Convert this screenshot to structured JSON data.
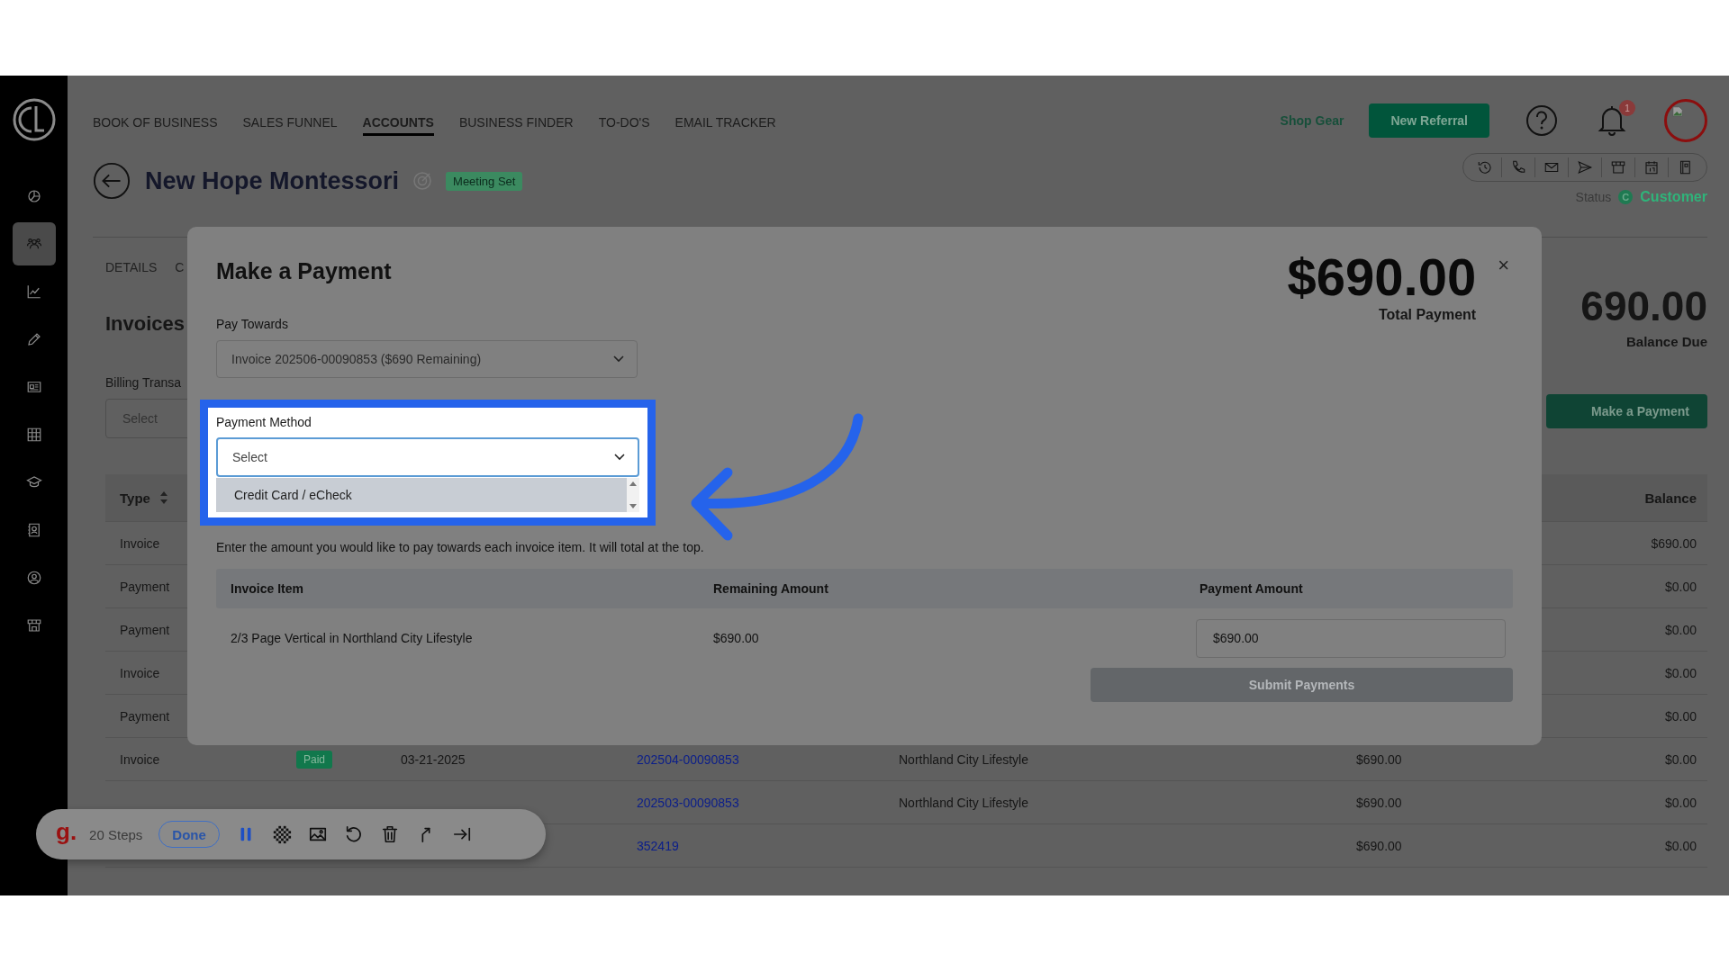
{
  "nav": {
    "items": [
      {
        "label": "BOOK OF BUSINESS",
        "selected": false
      },
      {
        "label": "SALES FUNNEL",
        "selected": false
      },
      {
        "label": "ACCOUNTS",
        "selected": true
      },
      {
        "label": "BUSINESS FINDER",
        "selected": false
      },
      {
        "label": "TO-DO'S",
        "selected": false
      },
      {
        "label": "EMAIL TRACKER",
        "selected": false
      }
    ],
    "shop_link": "Shop Gear",
    "referral_button": "New Referral",
    "notification_count": "1"
  },
  "sidebar": {
    "items": [
      {
        "selected": false
      },
      {
        "selected": true
      },
      {
        "selected": false
      },
      {
        "selected": false
      },
      {
        "selected": false
      },
      {
        "selected": false
      },
      {
        "selected": false
      },
      {
        "selected": false
      },
      {
        "selected": false
      },
      {
        "selected": false
      }
    ]
  },
  "account": {
    "name": "New Hope Montessori",
    "badge": "Meeting Set",
    "status_label": "Status",
    "status_icon": "C",
    "status": "Customer"
  },
  "tabs": [
    {
      "label": "DETAILS",
      "selected": false
    },
    {
      "label": "C",
      "selected": false
    }
  ],
  "invoices": {
    "title": "Invoices",
    "balance": "690.00",
    "balance_label": "Balance Due",
    "filter_label": "Billing Transa",
    "filter_placeholder": "Select",
    "pay_button": "Make a Payment",
    "header": {
      "type": "Type",
      "balance": "Balance"
    },
    "rows": [
      {
        "type": "Invoice",
        "balance": "$690.00"
      },
      {
        "type": "Payment",
        "balance": "$0.00"
      },
      {
        "type": "Payment",
        "balance": "$0.00"
      },
      {
        "type": "Invoice",
        "balance": "$0.00"
      },
      {
        "type": "Payment",
        "balance": "$0.00"
      },
      {
        "type": "Invoice",
        "status": "Paid",
        "date": "03-21-2025",
        "number": "202504-00090853",
        "description": "Northland City Lifestyle",
        "amount": "$690.00",
        "balance": "$0.00"
      },
      {
        "number": "202503-00090853",
        "description": "Northland City Lifestyle",
        "amount": "$690.00",
        "balance": "$0.00"
      },
      {
        "number": "352419",
        "amount": "$690.00",
        "balance": "$0.00"
      }
    ]
  },
  "modal": {
    "title": "Make a Payment",
    "total": "$690.00",
    "total_label": "Total Payment",
    "close": "×",
    "pay_towards_label": "Pay Towards",
    "pay_towards_value": "Invoice 202506-00090853 ($690 Remaining)",
    "method_label": "Payment Method",
    "method_placeholder": "Select",
    "method_options": [
      {
        "label": "Credit Card / eCheck",
        "selected": true
      }
    ],
    "instructions": "Enter the amount you would like to pay towards each invoice item. It will total at the top.",
    "columns": [
      "Invoice Item",
      "Remaining Amount",
      "Payment Amount"
    ],
    "items": [
      {
        "item": "2/3 Page Vertical in Northland City Lifestyle",
        "remaining": "$690.00",
        "payment": "$690.00"
      }
    ],
    "submit": {
      "label": "Submit Payments",
      "disabled": true
    }
  },
  "recorder": {
    "logo": "g.",
    "steps": "20 Steps",
    "done": "Done"
  }
}
